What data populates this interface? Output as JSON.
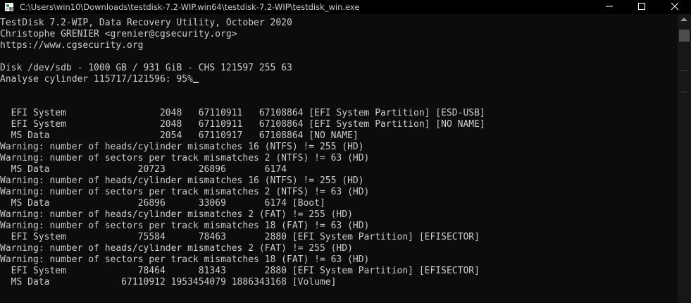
{
  "window": {
    "title": "C:\\Users\\win10\\Downloads\\testdisk-7.2-WIP.win64\\testdisk-7.2-WIP\\testdisk_win.exe",
    "icon": "testdisk-app-icon",
    "controls": {
      "minimize": "minimize-icon",
      "maximize": "maximize-icon",
      "close": "close-icon"
    }
  },
  "terminal": {
    "lines": [
      "TestDisk 7.2-WIP, Data Recovery Utility, October 2020",
      "Christophe GRENIER <grenier@cgsecurity.org>",
      "https://www.cgsecurity.org",
      "",
      "Disk /dev/sdb - 1000 GB / 931 GiB - CHS 121597 255 63",
      "Analyse cylinder 115717/121596: 95%",
      "",
      "",
      "  EFI System                 2048   67110911   67108864 [EFI System Partition] [ESD-USB]",
      "  EFI System                 2048   67110911   67108864 [EFI System Partition] [NO NAME]",
      "  MS Data                    2054   67110917   67108864 [NO NAME]",
      "Warning: number of heads/cylinder mismatches 16 (NTFS) != 255 (HD)",
      "Warning: number of sectors per track mismatches 2 (NTFS) != 63 (HD)",
      "  MS Data                20723      26896       6174",
      "Warning: number of heads/cylinder mismatches 16 (NTFS) != 255 (HD)",
      "Warning: number of sectors per track mismatches 2 (NTFS) != 63 (HD)",
      "  MS Data                26896      33069       6174 [Boot]",
      "Warning: number of heads/cylinder mismatches 2 (FAT) != 255 (HD)",
      "Warning: number of sectors per track mismatches 18 (FAT) != 63 (HD)",
      "  EFI System             75584      78463       2880 [EFI System Partition] [EFISECTOR]",
      "Warning: number of heads/cylinder mismatches 2 (FAT) != 255 (HD)",
      "Warning: number of sectors per track mismatches 18 (FAT) != 63 (HD)",
      "  EFI System             78464      81343       2880 [EFI System Partition] [EFISECTOR]",
      "  MS Data             67110912 1953454079 1886343168 [Volume]"
    ],
    "cursor_line": 5
  },
  "colors": {
    "background": "#0c0c0c",
    "text": "#cccccc",
    "titlebar": "#000000",
    "scrollbar_track": "#171717",
    "scrollbar_thumb": "#4d4d4d"
  }
}
